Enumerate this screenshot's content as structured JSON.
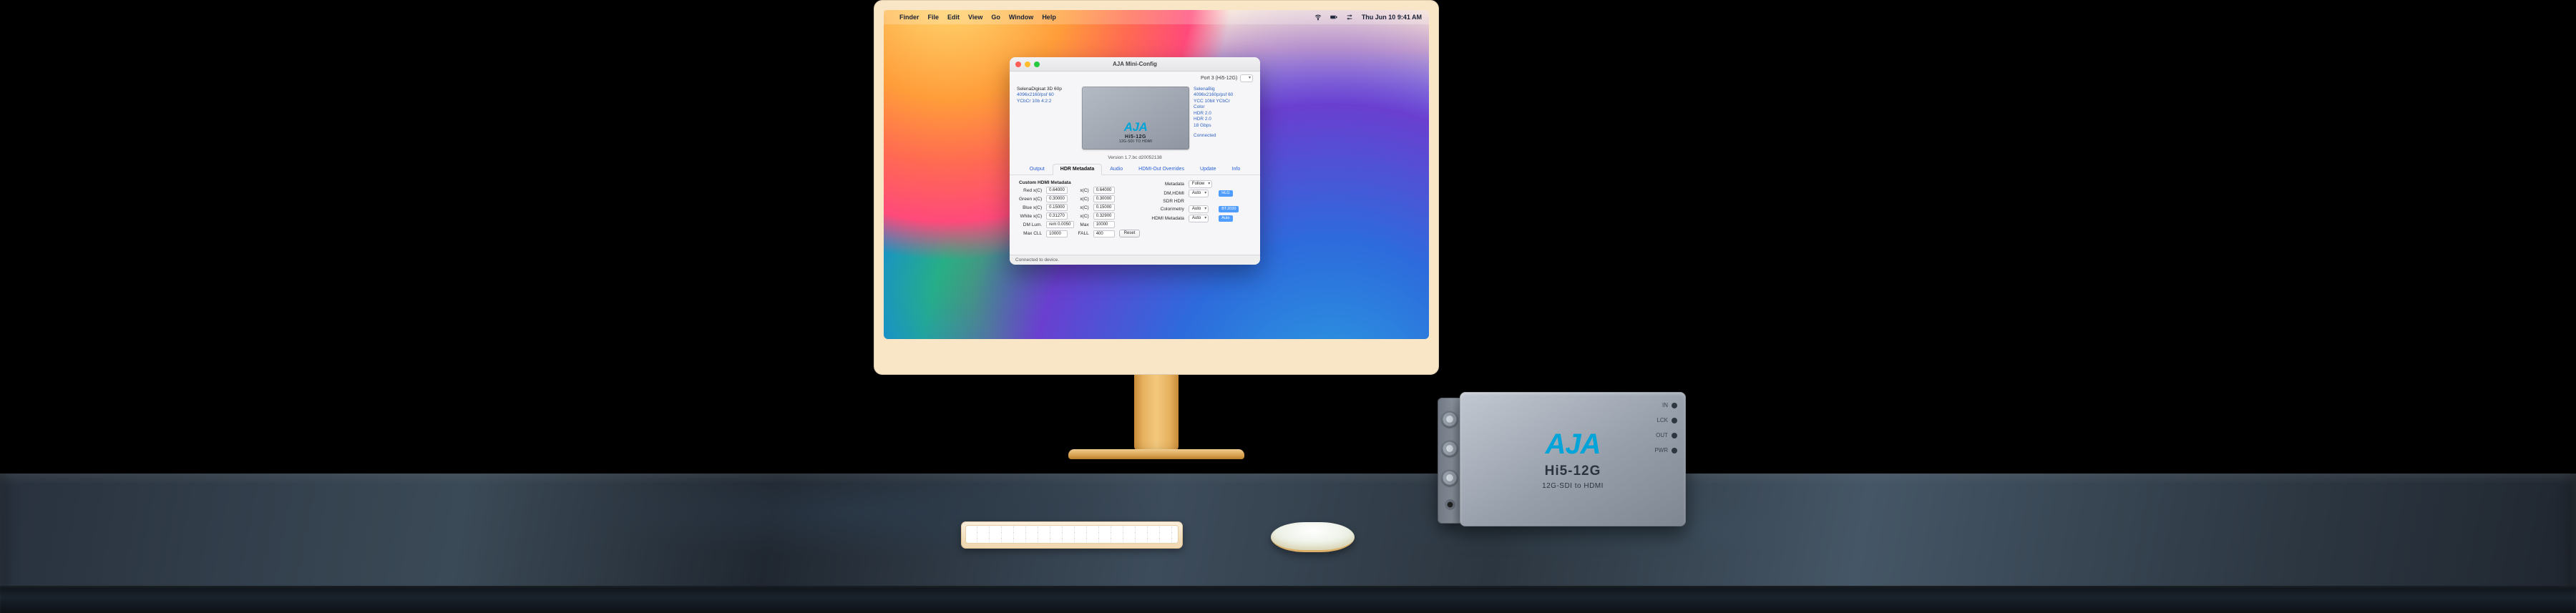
{
  "menubar": {
    "apple": "",
    "app_name": "Finder",
    "items": [
      "File",
      "Edit",
      "View",
      "Go",
      "Window",
      "Help"
    ],
    "clock": "Thu Jun 10  9:41 AM"
  },
  "window": {
    "title": "AJA Mini-Config",
    "port_label": "Port 3 (Hi5-12G)",
    "meta_left": {
      "l1": "SelenaDigisat 3D 60p",
      "l1val": "",
      "l2": "4096x2160/psf 60",
      "l3": "YCbCr 10b 4:2:2"
    },
    "meta_right": {
      "r1": "SelenaBig",
      "r2": "4096x2160p/psf 60",
      "r3": "YCC 10bit YCbCr",
      "r4": "Color",
      "r5a": "HDR 2.0",
      "r5b": "HDR 2.0",
      "r6": "18 Gbps",
      "status": "Connected"
    },
    "device": {
      "brand": "AJA",
      "model": "Hi5-12G",
      "sub": "12G-SDI TO HDMI"
    },
    "version": "Version  1.7.bc  d20052138",
    "tabs": [
      "Output",
      "HDR Metadata",
      "Audio",
      "HDMI-Out Overrides",
      "Update",
      "Info"
    ],
    "active_tab": 1,
    "left_table": {
      "title": "Custom HDMI Metadata",
      "rows": [
        {
          "label": "Red x(C)",
          "v1": "0.64000",
          "v2": "x(C)",
          "v3": "0.64000"
        },
        {
          "label": "Green x(C)",
          "v1": "0.30000",
          "v2": "x(C)",
          "v3": "0.30000"
        },
        {
          "label": "Blue x(C)",
          "v1": "0.15000",
          "v2": "x(C)",
          "v3": "0.15000"
        },
        {
          "label": "White x(C)",
          "v1": "0.31270",
          "v2": "x(C)",
          "v3": "0.32900"
        },
        {
          "label": "DM Lum.",
          "v1": "rem 0.0050",
          "v2": "Max",
          "v3": "10000"
        },
        {
          "label": "Max CLL",
          "v1": "10000",
          "v2": "FALL",
          "v3": "400"
        }
      ],
      "reset": "Reset"
    },
    "right_col": [
      {
        "label": "Metadata",
        "value": "Follow",
        "badge": ""
      },
      {
        "label": "DM,HDMI",
        "value": "Auto",
        "badge": "HLG"
      },
      {
        "label": "SDR HDR",
        "value": "",
        "badge": ""
      },
      {
        "label": "Colorimetry",
        "value": "Auto",
        "badge": "BT.2020"
      },
      {
        "label": "HDMI Metadata",
        "value": "Auto",
        "badge": "Auto"
      }
    ],
    "status_bar": "Connected to device."
  },
  "hardware": {
    "brand": "AJA",
    "model": "Hi5-12G",
    "sub": "12G-SDI to HDMI",
    "leds": [
      "IN",
      "LCK",
      "OUT",
      "PWR"
    ]
  }
}
